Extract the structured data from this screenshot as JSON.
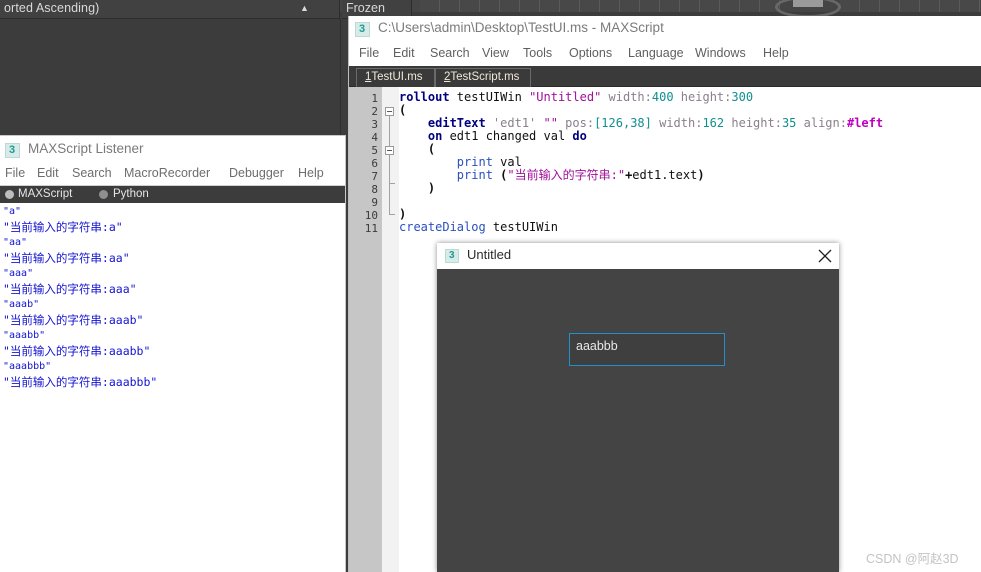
{
  "max_background": {
    "explorer": {
      "column_header_label": "orted Ascending)",
      "sort_indicator": "▲",
      "frozen_column_label": "Frozen"
    }
  },
  "listener": {
    "title": "MAXScript Listener",
    "icon_glyph": "3",
    "menus": [
      "File",
      "Edit",
      "Search",
      "MacroRecorder",
      "Debugger",
      "Help"
    ],
    "mode_maxscript": "MAXScript",
    "mode_python": "Python",
    "output_lines": [
      "\"a\"",
      "\"当前输入的字符串:a\"",
      "\"aa\"",
      "\"当前输入的字符串:aa\"",
      "\"aaa\"",
      "\"当前输入的字符串:aaa\"",
      "\"aaab\"",
      "\"当前输入的字符串:aaab\"",
      "\"aaabb\"",
      "\"当前输入的字符串:aaabb\"",
      "\"aaabbb\"",
      "\"当前输入的字符串:aaabbb\""
    ]
  },
  "editor": {
    "title": "C:\\Users\\admin\\Desktop\\TestUI.ms - MAXScript",
    "icon_glyph": "3",
    "menus": [
      "File",
      "Edit",
      "Search",
      "View",
      "Tools",
      "Options",
      "Language",
      "Windows",
      "Help"
    ],
    "tabs": [
      {
        "index": "1",
        "name": "TestUI.ms",
        "active": true
      },
      {
        "index": "2",
        "name": "TestScript.ms",
        "active": false
      }
    ],
    "line_numbers": [
      "1",
      "2",
      "3",
      "4",
      "5",
      "6",
      "7",
      "8",
      "9",
      "10",
      "11"
    ],
    "code_lines": [
      "rollout testUIWin \"Untitled\" width:400 height:300",
      "(",
      "    editText 'edt1' \"\" pos:[126,38] width:162 height:35 align:#left",
      "    on edt1 changed val do",
      "    (",
      "        print val",
      "        print (\"当前输入的字符串:\"+edt1.text)",
      "    )",
      "",
      ")",
      "createDialog testUIWin"
    ]
  },
  "dialog": {
    "title": "Untitled",
    "icon_glyph": "3",
    "close_label": "✕",
    "edit_field_value": "aaabbb"
  },
  "watermark": "CSDN @阿赵3D",
  "colors": {
    "max_dark": "#3c3c3c",
    "dialog_body": "#444444",
    "focus_border": "#1e90d0",
    "listener_text": "#1414d2",
    "keyword": "#000080",
    "string": "#a0109a",
    "number": "#0f8f8f"
  }
}
